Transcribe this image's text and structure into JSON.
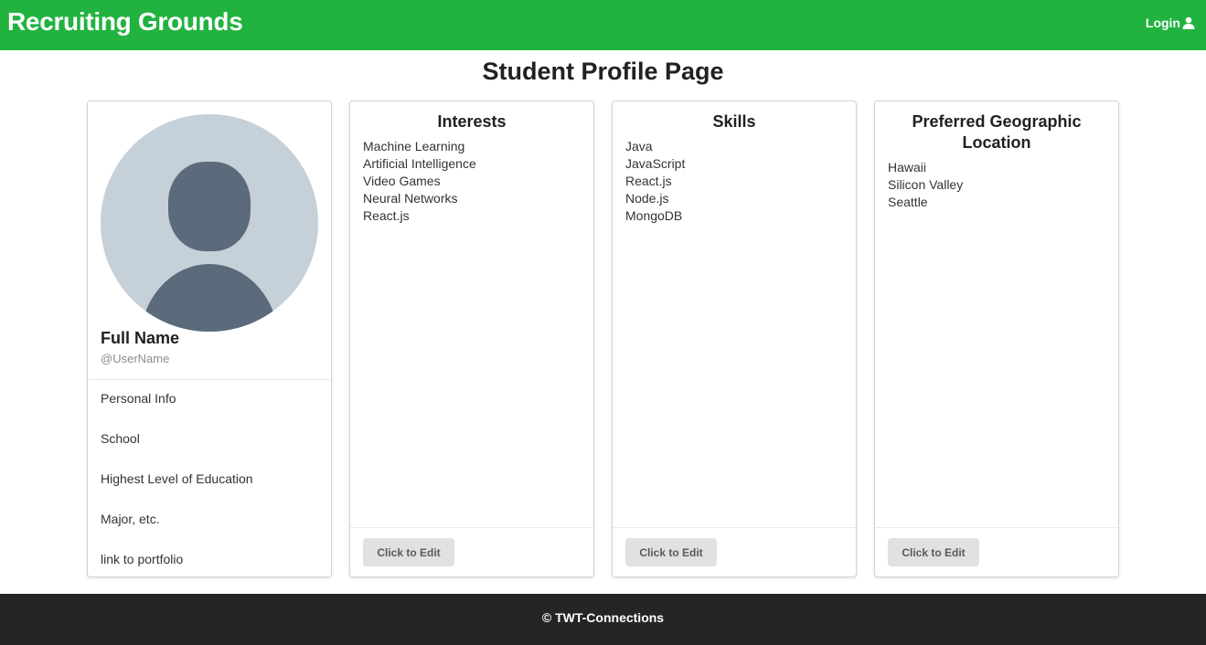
{
  "header": {
    "brand": "Recruiting Grounds",
    "login_label": "Login",
    "login_icon": "user-icon",
    "background": "#21b23f"
  },
  "page": {
    "title": "Student Profile Page"
  },
  "profile": {
    "avatar_icon": "user-avatar-placeholder",
    "full_name": "Full Name",
    "username": "@UserName",
    "info_items": [
      "Personal Info",
      "School",
      "Highest Level of Education",
      "Major, etc.",
      "link to portfolio"
    ]
  },
  "interests": {
    "title": "Interests",
    "items": [
      "Machine Learning",
      "Artificial Intelligence",
      "Video Games",
      "Neural Networks",
      "React.js"
    ],
    "edit_label": "Click to Edit"
  },
  "skills": {
    "title": "Skills",
    "items": [
      "Java",
      "JavaScript",
      "React.js",
      "Node.js",
      "MongoDB"
    ],
    "edit_label": "Click to Edit"
  },
  "locations": {
    "title": "Preferred Geographic Location",
    "items": [
      "Hawaii",
      "Silicon Valley",
      "Seattle"
    ],
    "edit_label": "Click to Edit"
  },
  "footer": {
    "text": "© TWT-Connections",
    "background": "#252525"
  }
}
